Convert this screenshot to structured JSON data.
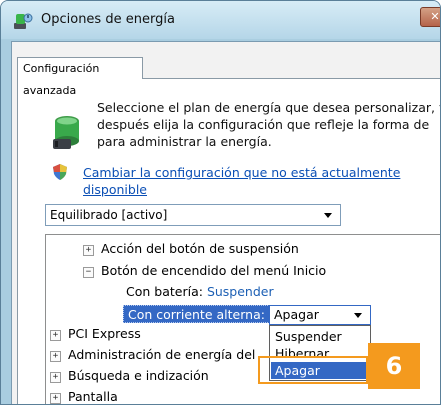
{
  "window": {
    "title": "Opciones de energía",
    "close_glyph": "✕"
  },
  "tabs": [
    {
      "label": "Configuración avanzada"
    }
  ],
  "intro": {
    "text": "Seleccione el plan de energía que desea personalizar, y después elija la configuración que refleje la forma de para administrar la energía.",
    "icon": "power-plan-icon"
  },
  "change_link": {
    "icon": "uac-shield-icon",
    "text": "Cambiar la configuración que no está actualmente disponible"
  },
  "plan_select": {
    "value": "Equilibrado [activo]"
  },
  "tree": {
    "items": [
      {
        "expander": "+",
        "label": "Acción del botón de suspensión"
      },
      {
        "expander": "−",
        "label": "Botón de encendido del menú Inicio"
      },
      {
        "label": "Con batería:",
        "value": "Suspender"
      },
      {
        "label": "Con corriente alterna:",
        "value": "Apagar"
      },
      {
        "expander": "+",
        "label": "PCI Express"
      },
      {
        "expander": "+",
        "label": "Administración de energía del"
      },
      {
        "expander": "+",
        "label": "Búsqueda e indización"
      },
      {
        "expander": "+",
        "label": "Pantalla"
      }
    ]
  },
  "dropdown": {
    "options": [
      "Suspender",
      "Hibernar",
      "Apagar"
    ],
    "selected": "Apagar"
  },
  "callout": {
    "number": "6",
    "color": "#f49a1e"
  },
  "colors": {
    "selection": "#3468c4",
    "link": "#0b4fb5"
  }
}
